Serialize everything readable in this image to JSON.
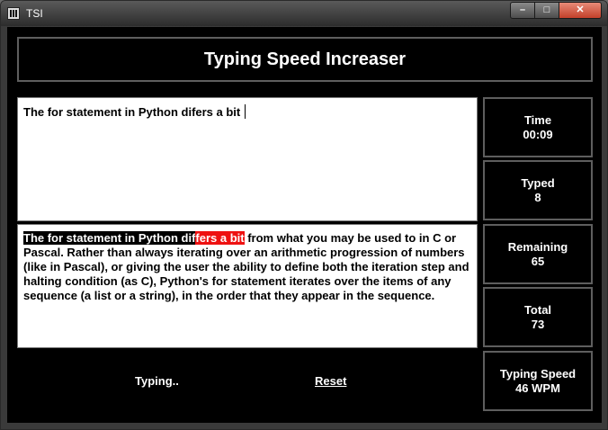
{
  "window": {
    "title": "TSI",
    "controls": {
      "minimize": "–",
      "maximize": "□",
      "close": "✕"
    }
  },
  "header": {
    "title": "Typing Speed Increaser"
  },
  "input": {
    "value": "The for statement in Python difers a bit "
  },
  "target": {
    "typed_correct": "The for statement in Python dif",
    "typed_error": "fers a bit",
    "remaining": " from what you may be used to in C or Pascal. Rather than always iterating over an arithmetic progression of numbers (like in Pascal), or giving the user the ability to define both the iteration step and halting condition (as C), Python's for statement iterates over the items of any sequence (a list or a string), in the order that they appear in the sequence."
  },
  "stats": {
    "time": {
      "label": "Time",
      "value": "00:09"
    },
    "typed": {
      "label": "Typed",
      "value": "8"
    },
    "remaining": {
      "label": "Remaining",
      "value": "65"
    },
    "total": {
      "label": "Total",
      "value": "73"
    },
    "speed": {
      "label": "Typing Speed",
      "value": "46 WPM"
    }
  },
  "footer": {
    "status": "Typing..",
    "reset_label": "Reset"
  },
  "colors": {
    "highlight_done": "#000000",
    "highlight_error": "#ee1111",
    "background": "#000000"
  }
}
